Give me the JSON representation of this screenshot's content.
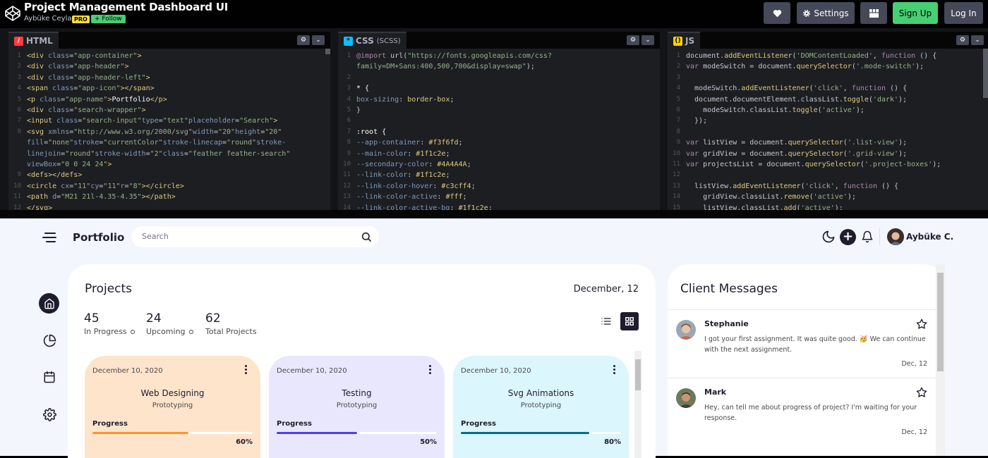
{
  "header": {
    "title": "Project Management Dashboard UI",
    "author": "Aybüke Ceylan",
    "pro_badge": "PRO",
    "follow_label": "+ Follow",
    "settings_label": "Settings",
    "signup_label": "Sign Up",
    "login_label": "Log In"
  },
  "panes": {
    "html": {
      "label": "HTML"
    },
    "css": {
      "label": "CSS",
      "sub": "(SCSS)"
    },
    "js": {
      "label": "JS"
    }
  },
  "app": {
    "name": "Portfolio",
    "search_placeholder": "Search",
    "user_name": "Aybüke C.",
    "projects_title": "Projects",
    "date": "December, 12",
    "stats": [
      {
        "num": "45",
        "label": "In Progress"
      },
      {
        "num": "24",
        "label": "Upcoming"
      },
      {
        "num": "62",
        "label": "Total Projects"
      }
    ],
    "cards": [
      {
        "date": "December 10, 2020",
        "title": "Web Designing",
        "sub": "Prototyping",
        "progress_label": "Progress",
        "pct": "60%",
        "value": 0.6,
        "bg": "#fee4cb",
        "bar": "#ff942e"
      },
      {
        "date": "December 10, 2020",
        "title": "Testing",
        "sub": "Prototyping",
        "progress_label": "Progress",
        "pct": "50%",
        "value": 0.5,
        "bg": "#e9e7fd",
        "bar": "#4f3ff0"
      },
      {
        "date": "December 10, 2020",
        "title": "Svg Animations",
        "sub": "Prototyping",
        "progress_label": "Progress",
        "pct": "80%",
        "value": 0.8,
        "bg": "#dbf6fd",
        "bar": "#096c86"
      }
    ],
    "messages_title": "Client Messages",
    "messages": [
      {
        "name": "Stephanie",
        "text": "I got your first assignment. It was quite good. 🥳 We can continue with the next assignment.",
        "date": "Dec, 12"
      },
      {
        "name": "Mark",
        "text": "Hey, can tell me about progress of project? I'm waiting for your response.",
        "date": "Dec, 12"
      }
    ]
  },
  "colors": {
    "accent_green": "#47cf73",
    "dark": "#1f1c2e",
    "app_bg": "#f3f6fd"
  }
}
